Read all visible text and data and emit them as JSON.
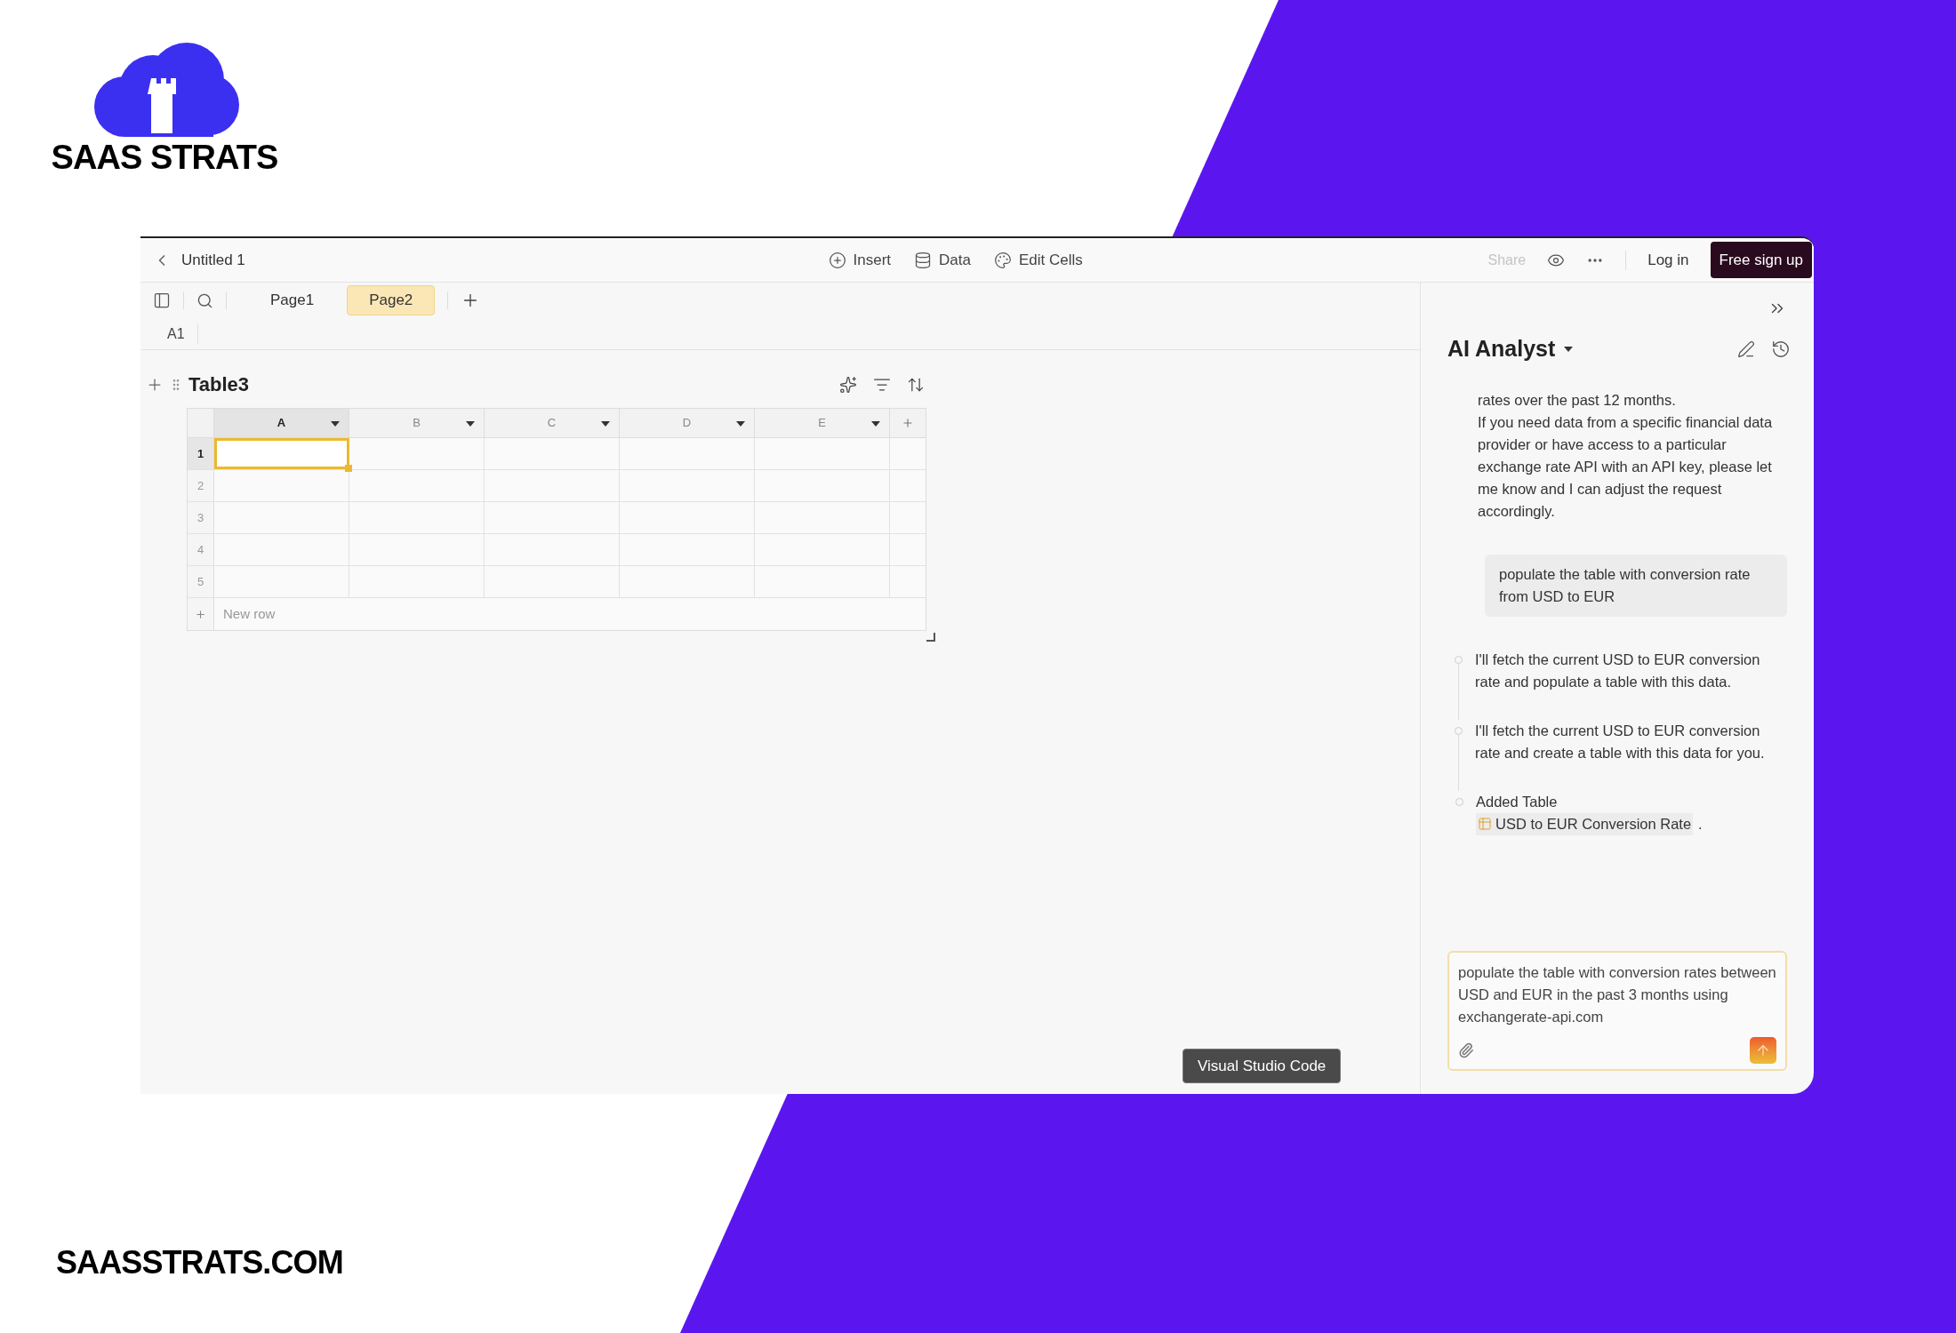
{
  "brand": {
    "name": "SAAS STRATS",
    "footer": "SAASSTRATS.COM"
  },
  "window": {
    "title": "Untitled 1"
  },
  "toolbar": [
    {
      "kind": "insert",
      "label": "Insert"
    },
    {
      "kind": "data",
      "label": "Data"
    },
    {
      "kind": "edit",
      "label": "Edit Cells"
    }
  ],
  "account": {
    "share": "Share",
    "share_disabled": true,
    "login": "Log in",
    "signup": "Free sign up"
  },
  "pages": [
    {
      "label": "Page1",
      "selected": false
    },
    {
      "label": "Page2",
      "selected": true
    }
  ],
  "cell_ref": "A1",
  "table": {
    "title": "Table3",
    "columns": [
      {
        "label": "A",
        "selected": true
      },
      {
        "label": "B",
        "selected": false
      },
      {
        "label": "C",
        "selected": false
      },
      {
        "label": "D",
        "selected": false
      },
      {
        "label": "E",
        "selected": false
      }
    ],
    "rows": [
      {
        "label": "1",
        "selected": true
      },
      {
        "label": "2",
        "selected": false
      },
      {
        "label": "3",
        "selected": false
      },
      {
        "label": "4",
        "selected": false
      },
      {
        "label": "5",
        "selected": false
      }
    ],
    "new_row": "New row"
  },
  "assistant": {
    "title": "AI Analyst",
    "paragraphs": [
      "rates over the past 12 months.",
      "If you need data from a specific financial data provider or have access to a particular exchange rate API with an API key, please let me know and I can adjust the request accordingly."
    ],
    "user_message": "populate the table with conversion rate from USD to EUR",
    "steps": [
      {
        "kind": "text",
        "text": "I'll fetch the current USD to EUR conversion rate and populate a table with this data."
      },
      {
        "kind": "text",
        "text": "I'll fetch the current USD to EUR conversion rate and create a table with this data for you."
      },
      {
        "kind": "added_table",
        "text": "Added Table",
        "table_name": "USD to EUR Conversion Rate",
        "suffix": "."
      }
    ],
    "input_value": "populate the table with conversion rates between USD and EUR in the past 3 months using exchangerate-api.com"
  },
  "tooltip": "Visual Studio Code"
}
